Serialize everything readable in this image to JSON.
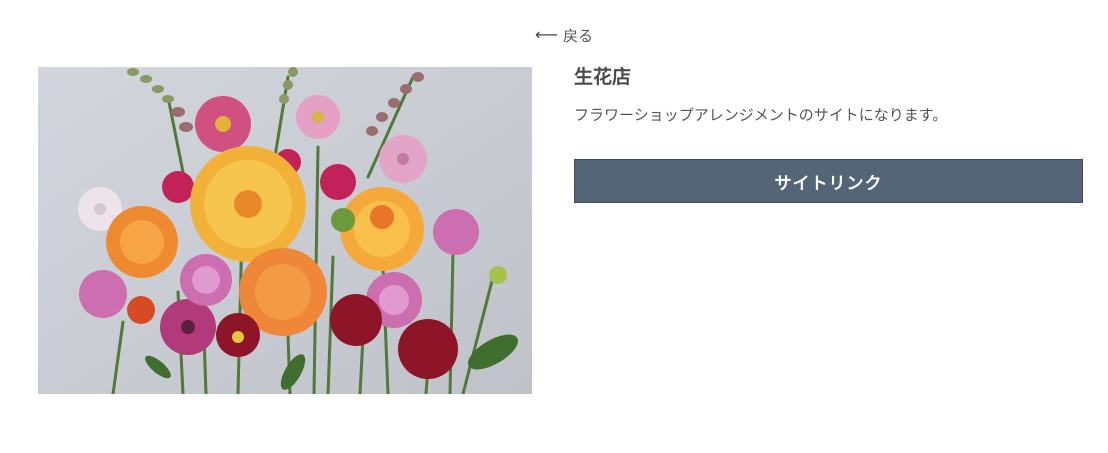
{
  "nav": {
    "back_label": "戻る",
    "back_icon": "arrow-left-icon"
  },
  "shop": {
    "title": "生花店",
    "description": "フラワーショップアレンジメントのサイトになります。",
    "link_button_label": "サイトリンク",
    "image_alt": "flower-arrangement-photo"
  },
  "colors": {
    "button_bg": "#546577",
    "text": "#444444",
    "photo_bg": "#c9ccd3"
  }
}
